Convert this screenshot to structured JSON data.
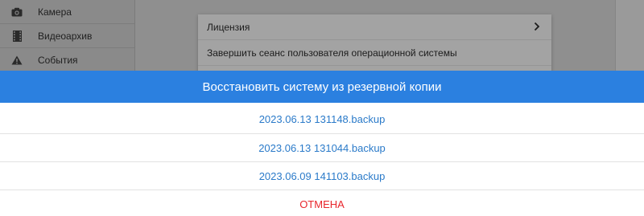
{
  "sidebar": {
    "items": [
      {
        "label": "Камера",
        "icon": "camera-icon"
      },
      {
        "label": "Видеоархив",
        "icon": "film-icon"
      },
      {
        "label": "События",
        "icon": "warning-icon"
      }
    ]
  },
  "menu": {
    "items": [
      {
        "label": "Лицензия",
        "icon": "chevron-right-icon"
      },
      {
        "label": "Завершить сеанс пользователя операционной системы"
      }
    ]
  },
  "dialog": {
    "title": "Восстановить систему из резервной копии",
    "options": [
      "2023.06.13 131148.backup",
      "2023.06.13 131044.backup",
      "2023.06.09 141103.backup"
    ],
    "cancel_label": "ОТМЕНА"
  },
  "colors": {
    "header_bg": "#2b80e0",
    "option_text": "#2a7ac9",
    "cancel_text": "#e8262c"
  }
}
